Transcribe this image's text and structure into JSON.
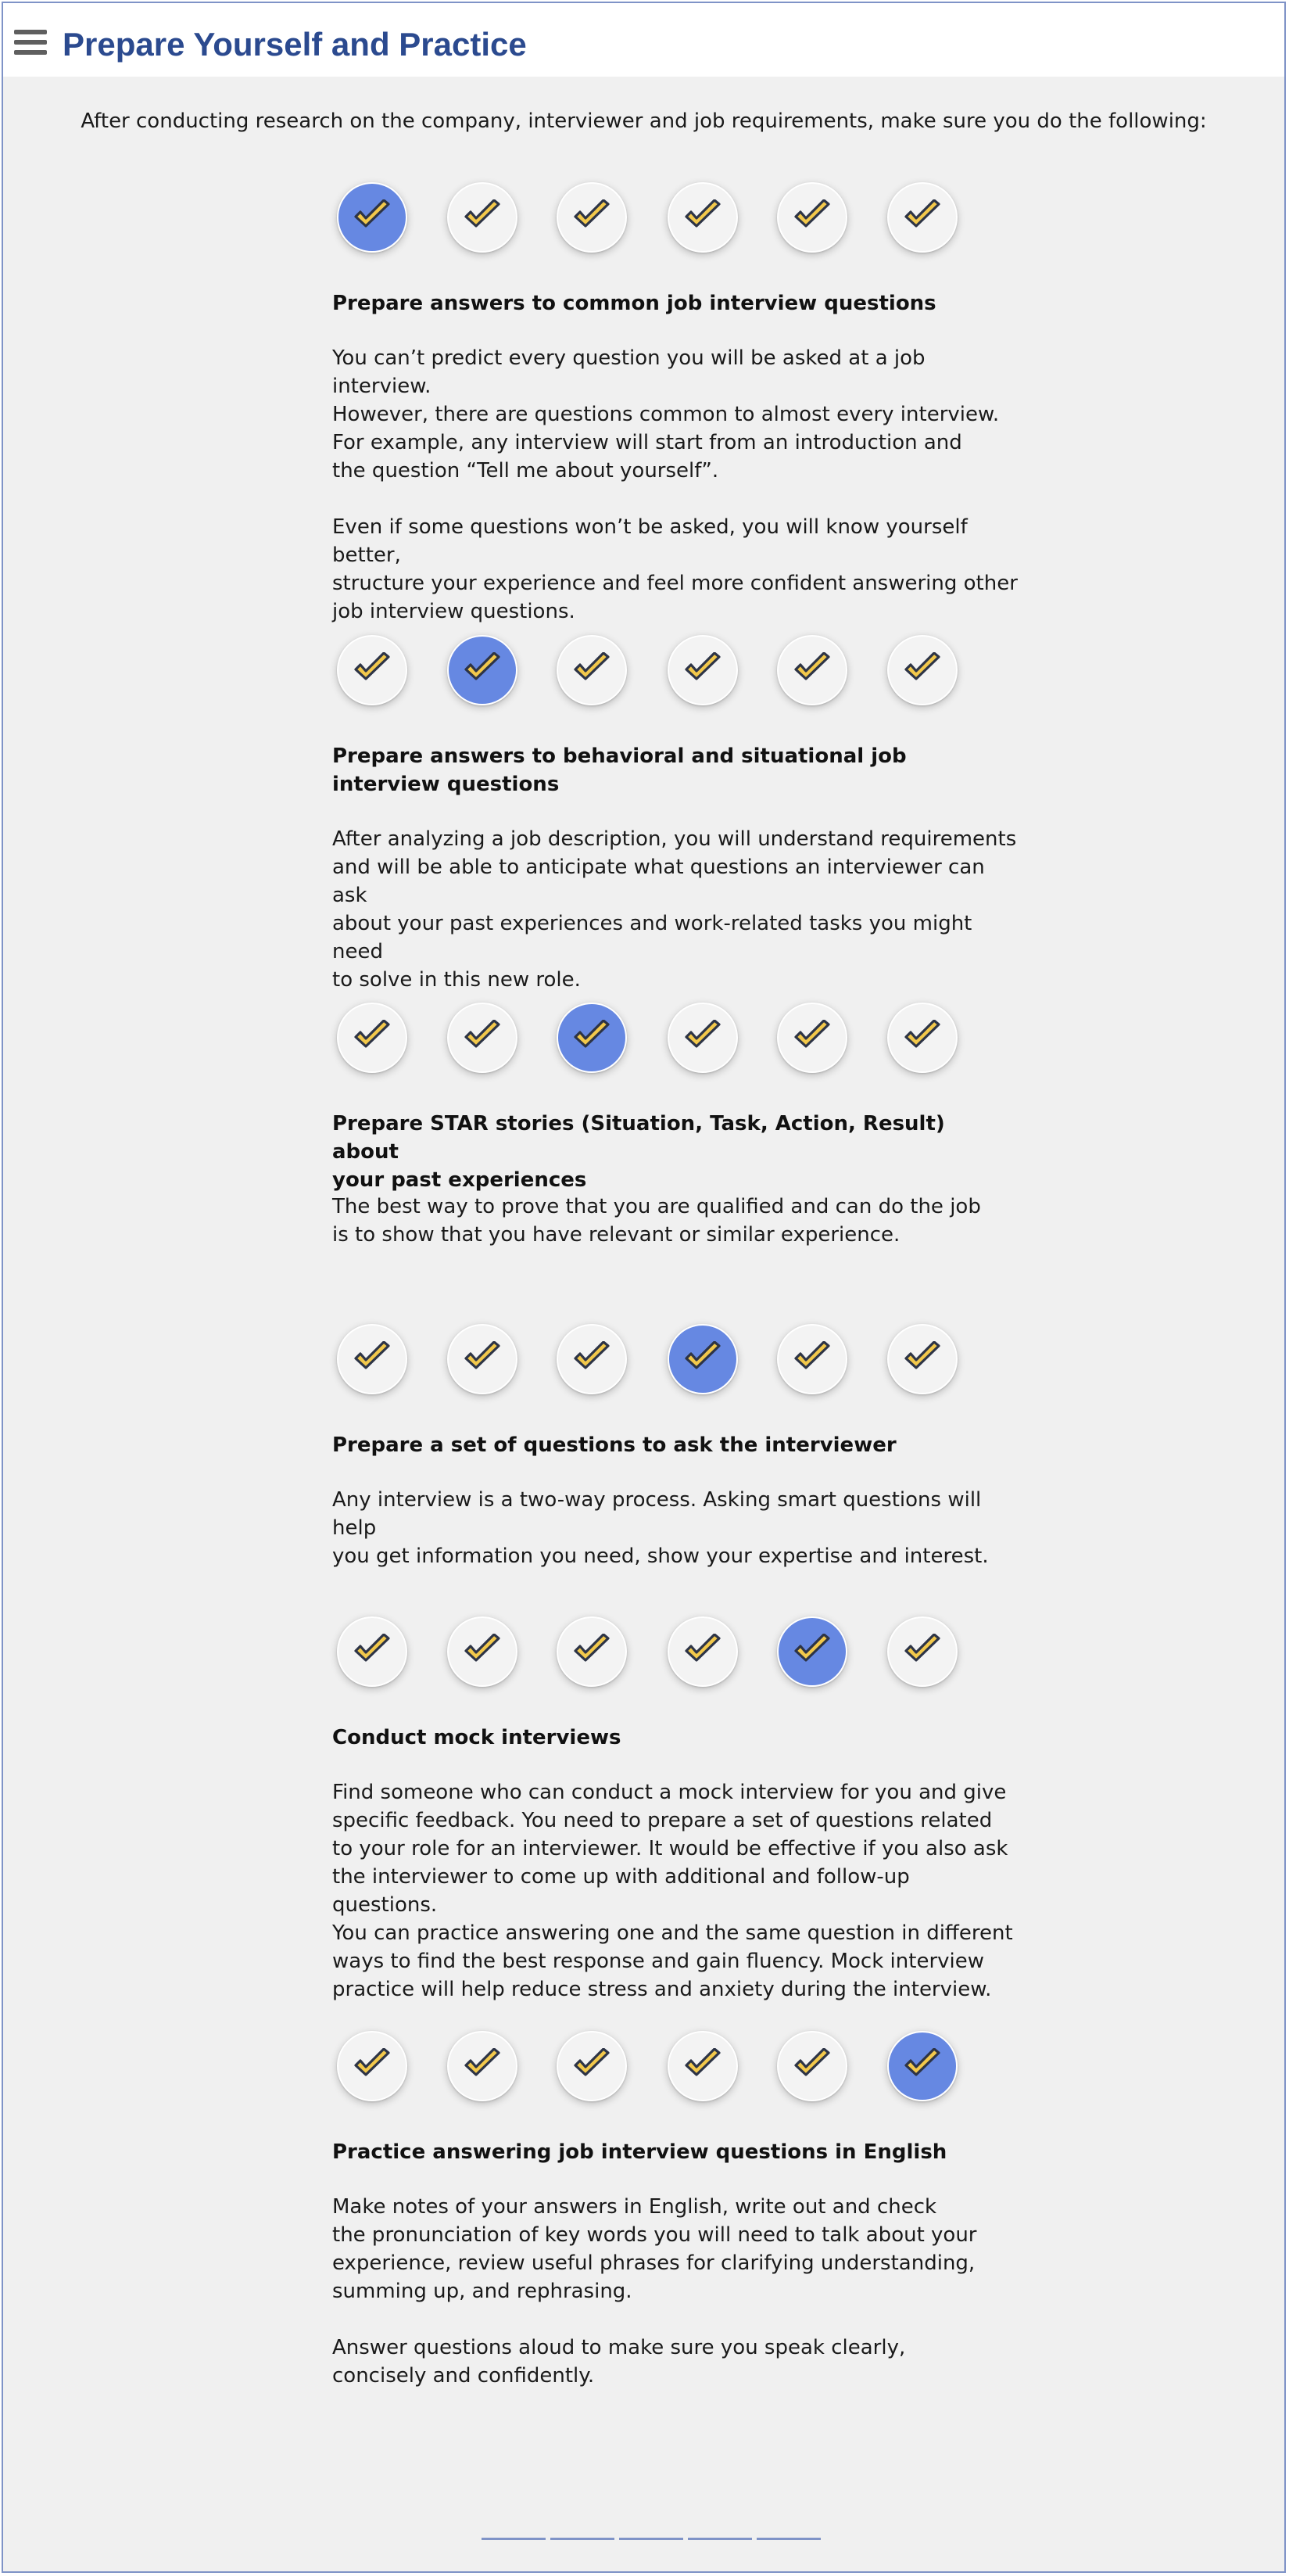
{
  "header": {
    "title": "Prepare Yourself and Practice",
    "menu_icon": "hamburger-menu-icon"
  },
  "intro": "After conducting research on the company, interviewer and job requirements, make sure you do the following:",
  "colors": {
    "active_circle": "#6688e2",
    "check_fill": "#f2c84b",
    "title": "#2b4a8f"
  },
  "sections": [
    {
      "title": "Prepare answers to common job interview questions",
      "body": "You can’t predict every question you will be asked at a job interview.\nHowever, there are questions common to almost every interview.\nFor example, any interview will start from an introduction and\nthe question “Tell me about yourself”.\n\nEven if some questions won’t be asked, you will know yourself better,\nstructure your experience and feel more confident answering other\njob interview questions."
    },
    {
      "title": "Prepare answers to behavioral and situational job\ninterview questions",
      "body": "After analyzing a job description, you will understand requirements\nand will be able to anticipate what questions an interviewer can ask\nabout your past experiences and work-related tasks you might need\nto solve in this new role."
    },
    {
      "title": "Prepare STAR stories (Situation, Task, Action, Result) about\nyour past experiences",
      "body": "The best way to prove that you are qualified and can do the job\nis to show that you have relevant or similar experience."
    },
    {
      "title": "Prepare a set of questions to ask the interviewer",
      "body": "Any interview is a two-way process. Asking smart questions will help\nyou get information you need, show your expertise and interest."
    },
    {
      "title": "Conduct mock interviews",
      "body": "Find someone who can conduct a mock interview for you and give\nspecific feedback. You need to prepare a set of questions related\nto your role for an interviewer. It would be effective if you also ask\nthe interviewer to come up with additional and follow-up questions.\nYou can practice answering one and the same question in different\nways to find the best response and gain fluency. Mock interview\npractice will help reduce stress and anxiety during the interview."
    },
    {
      "title": "Practice answering job interview questions in English",
      "body": "Make notes of your answers in English, write out and check\nthe pronunciation of key words you will need to talk about your\nexperience, review useful phrases for clarifying understanding,\nsumming up, and rephrasing.\n\nAnswer questions aloud to make sure you speak clearly,\nconcisely and confidently."
    }
  ],
  "pager": {
    "count": 5
  }
}
